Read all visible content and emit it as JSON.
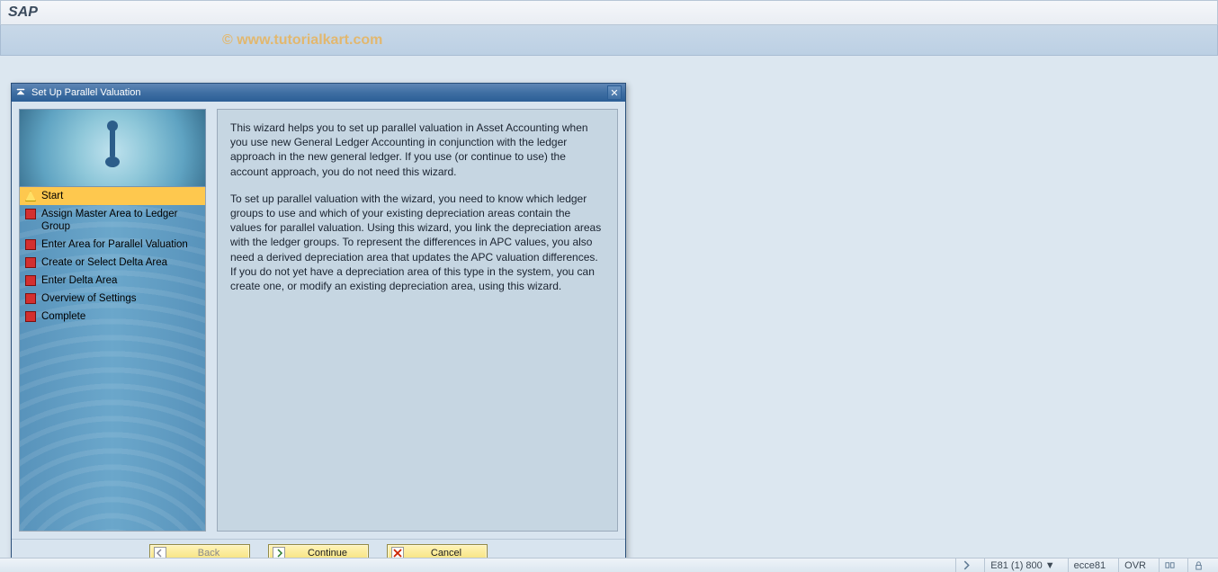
{
  "app": {
    "title": "SAP"
  },
  "watermark": "© www.tutorialkart.com",
  "dialog": {
    "title": "Set Up Parallel Valuation",
    "steps": [
      {
        "label": "Start",
        "status": "active"
      },
      {
        "label": "Assign Master Area to Ledger Group",
        "status": "pending"
      },
      {
        "label": "Enter Area for Parallel Valuation",
        "status": "pending"
      },
      {
        "label": "Create or Select Delta Area",
        "status": "pending"
      },
      {
        "label": "Enter Delta Area",
        "status": "pending"
      },
      {
        "label": "Overview of Settings",
        "status": "pending"
      },
      {
        "label": "Complete",
        "status": "pending"
      }
    ],
    "body": {
      "para1": "This wizard helps you to set up parallel valuation in Asset Accounting when you use new General Ledger Accounting in conjunction with the ledger approach in the new general ledger. If you use (or continue to use) the account approach, you do not need this wizard.",
      "para2": "To set up parallel valuation with the wizard, you need to know which ledger groups to use and which of your existing depreciation areas contain the values for parallel valuation. Using this wizard, you link the depreciation areas with the ledger groups. To represent the differences in APC values, you also need a derived depreciation area that updates the APC valuation differences. If you do not yet have a depreciation area of this type in the system, you can create one, or modify an existing depreciation area, using this wizard."
    },
    "buttons": {
      "back": "Back",
      "continue": "Continue",
      "cancel": "Cancel"
    }
  },
  "statusbar": {
    "system": "E81 (1) 800",
    "server": "ecce81",
    "mode": "OVR"
  }
}
